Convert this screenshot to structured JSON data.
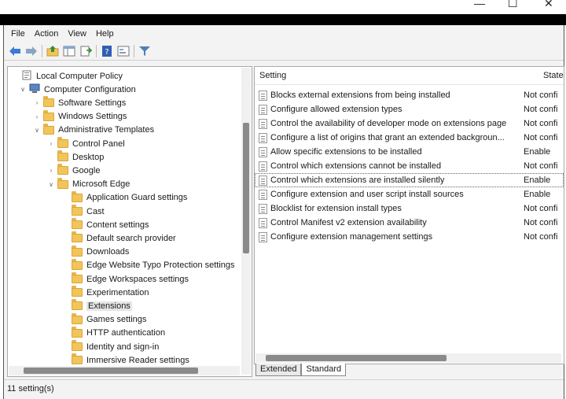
{
  "menu": [
    "File",
    "Action",
    "View",
    "Help"
  ],
  "toolbar_icons": [
    "back-icon",
    "forward-icon",
    "up-folder-icon",
    "show-hide-tree-icon",
    "export-list-icon",
    "help-icon",
    "properties-icon",
    "filter-icon"
  ],
  "window_controls": {
    "minimize": "—",
    "maximize": "☐",
    "close": "✕"
  },
  "tree": [
    {
      "label": "Local Computer Policy",
      "depth": 0,
      "twisty": "",
      "icon": "computer-policy-icon"
    },
    {
      "label": "Computer Configuration",
      "depth": 1,
      "twisty": "∨",
      "icon": "computer-icon"
    },
    {
      "label": "Software Settings",
      "depth": 2,
      "twisty": "›",
      "icon": "folder-icon"
    },
    {
      "label": "Windows Settings",
      "depth": 2,
      "twisty": "›",
      "icon": "folder-icon"
    },
    {
      "label": "Administrative Templates",
      "depth": 2,
      "twisty": "∨",
      "icon": "folder-icon"
    },
    {
      "label": "Control Panel",
      "depth": 3,
      "twisty": "›",
      "icon": "folder-icon"
    },
    {
      "label": "Desktop",
      "depth": 3,
      "twisty": "",
      "icon": "folder-icon"
    },
    {
      "label": "Google",
      "depth": 3,
      "twisty": "›",
      "icon": "folder-icon"
    },
    {
      "label": "Microsoft Edge",
      "depth": 3,
      "twisty": "∨",
      "icon": "folder-icon"
    },
    {
      "label": "Application Guard settings",
      "depth": 4,
      "twisty": "",
      "icon": "folder-icon"
    },
    {
      "label": "Cast",
      "depth": 4,
      "twisty": "",
      "icon": "folder-icon"
    },
    {
      "label": "Content settings",
      "depth": 4,
      "twisty": "",
      "icon": "folder-icon"
    },
    {
      "label": "Default search provider",
      "depth": 4,
      "twisty": "",
      "icon": "folder-icon"
    },
    {
      "label": "Downloads",
      "depth": 4,
      "twisty": "",
      "icon": "folder-icon"
    },
    {
      "label": "Edge Website Typo Protection settings",
      "depth": 4,
      "twisty": "",
      "icon": "folder-icon"
    },
    {
      "label": "Edge Workspaces settings",
      "depth": 4,
      "twisty": "",
      "icon": "folder-icon"
    },
    {
      "label": "Experimentation",
      "depth": 4,
      "twisty": "",
      "icon": "folder-icon"
    },
    {
      "label": "Extensions",
      "depth": 4,
      "twisty": "",
      "icon": "folder-icon",
      "selected": true
    },
    {
      "label": "Games settings",
      "depth": 4,
      "twisty": "",
      "icon": "folder-icon"
    },
    {
      "label": "HTTP authentication",
      "depth": 4,
      "twisty": "",
      "icon": "folder-icon"
    },
    {
      "label": "Identity and sign-in",
      "depth": 4,
      "twisty": "",
      "icon": "folder-icon"
    },
    {
      "label": "Immersive Reader settings",
      "depth": 4,
      "twisty": "",
      "icon": "folder-icon"
    }
  ],
  "columns": {
    "setting": "Setting",
    "state": "State"
  },
  "settings": [
    {
      "name": "Blocks external extensions from being installed",
      "state": "Not confi"
    },
    {
      "name": "Configure allowed extension types",
      "state": "Not confi"
    },
    {
      "name": "Control the availability of developer mode on extensions page",
      "state": "Not confi"
    },
    {
      "name": "Configure a list of origins that grant an extended backgroun...",
      "state": "Not confi"
    },
    {
      "name": "Allow specific extensions to be installed",
      "state": "Enable"
    },
    {
      "name": "Control which extensions cannot be installed",
      "state": "Not confi"
    },
    {
      "name": "Control which extensions are installed silently",
      "state": "Enable",
      "selected": true
    },
    {
      "name": "Configure extension and user script install sources",
      "state": "Enable"
    },
    {
      "name": "Blocklist for extension install types",
      "state": "Not confi"
    },
    {
      "name": "Control Manifest v2 extension availability",
      "state": "Not confi"
    },
    {
      "name": "Configure extension management settings",
      "state": "Not confi"
    }
  ],
  "tabs": [
    {
      "label": "Extended",
      "active": false
    },
    {
      "label": "Standard",
      "active": true
    }
  ],
  "status": "11 setting(s)"
}
